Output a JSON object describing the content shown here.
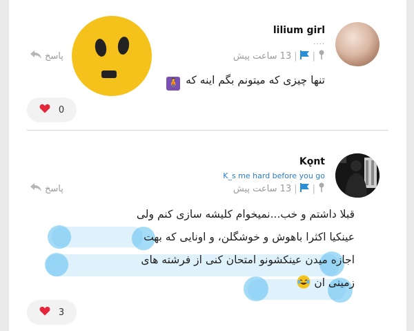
{
  "comments": [
    {
      "username": "lilium girl",
      "dots": "....",
      "time": "13 ساعت پیش",
      "reply_label": "پاسخ",
      "text": "تنها چیزی که میتونم بگم اینه که",
      "likes": "0"
    },
    {
      "username": "Kǫnt",
      "tagline": "K_s me hard before you go",
      "time": "13 ساعت پیش",
      "reply_label": "پاسخ",
      "lines": [
        "قبلا داشتم و خب...نمیخوام کلیشه سازی کنم ولی",
        "عینکیا اکثرا باهوش و خوشگلن، و اونایی که بهت",
        "اجازه میدن عینکشونو امتحان کنی از فرشته های",
        "زمینی ان"
      ],
      "likes": "3"
    }
  ],
  "colors": {
    "accent_blue": "#2b7cc4",
    "heart_red": "#e3263a",
    "emoji_yellow": "#f5c21b",
    "highlight": "#5abef0"
  }
}
